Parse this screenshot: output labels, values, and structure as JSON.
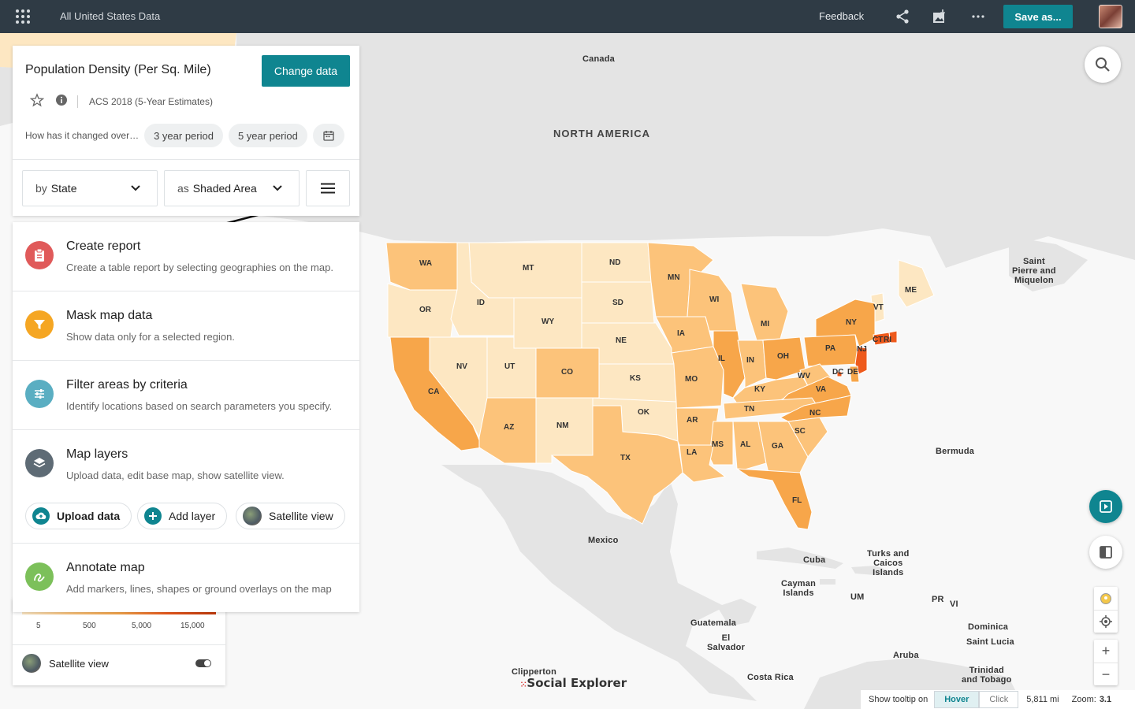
{
  "header": {
    "title": "All United States Data",
    "feedback_label": "Feedback",
    "save_label": "Save as..."
  },
  "panel": {
    "title": "Population Density (Per Sq. Mile)",
    "change_data_label": "Change data",
    "source": "ACS 2018 (5-Year Estimates)",
    "change_prompt": "How has it changed over…",
    "period_3": "3 year period",
    "period_5": "5 year period",
    "by_prefix": "by",
    "by_value": "State",
    "as_prefix": "as",
    "as_value": "Shaded Area"
  },
  "menu": {
    "create_report": {
      "title": "Create report",
      "desc": "Create a table report by selecting geographies on the map."
    },
    "mask": {
      "title": "Mask map data",
      "desc": "Show data only for a selected region."
    },
    "filter": {
      "title": "Filter areas by criteria",
      "desc": "Identify locations based on search parameters you specify."
    },
    "layers": {
      "title": "Map layers",
      "desc": "Upload data, edit base map, show satellite view."
    },
    "upload_label": "Upload data",
    "add_layer_label": "Add layer",
    "satellite_label": "Satellite view",
    "annotate": {
      "title": "Annotate map",
      "desc": "Add markers, lines, shapes or ground overlays on the map"
    }
  },
  "legend": {
    "ticks": [
      "5",
      "500",
      "5,000",
      "15,000"
    ],
    "satellite_label": "Satellite view"
  },
  "map_labels": {
    "canada": "Canada",
    "north_america": "NORTH AMERICA",
    "spm": "Saint\nPierre and\nMiquelon",
    "bermuda": "Bermuda",
    "mexico": "Mexico",
    "cuba": "Cuba",
    "turks": "Turks and\nCaicos\nIslands",
    "cayman": "Cayman\nIslands",
    "um": "UM",
    "pr": "PR",
    "vi": "VI",
    "dominica": "Dominica",
    "saint_lucia": "Saint Lucia",
    "guatemala": "Guatemala",
    "el_salvador": "El\nSalvador",
    "aruba": "Aruba",
    "trinidad": "Trinidad\nand Tobago",
    "clipperton": "Clipperton",
    "costa_rica": "Costa Rica"
  },
  "states": [
    "WA",
    "MT",
    "ND",
    "MN",
    "ME",
    "OR",
    "ID",
    "SD",
    "WI",
    "VT",
    "NY",
    "MI",
    "WY",
    "NE",
    "IA",
    "PA",
    "CT",
    "RI",
    "NJ",
    "NV",
    "UT",
    "CO",
    "KS",
    "IL",
    "IN",
    "OH",
    "DE",
    "DC",
    "CA",
    "MO",
    "WV",
    "KY",
    "VA",
    "OK",
    "TN",
    "AR",
    "NC",
    "AZ",
    "NM",
    "SC",
    "TX",
    "MS",
    "AL",
    "GA",
    "LA",
    "FL"
  ],
  "status": {
    "tooltip_label": "Show tooltip on",
    "hover": "Hover",
    "click": "Click",
    "scale": "5,811 mi",
    "zoom_label": "Zoom:",
    "zoom_value": "3.1"
  },
  "logo": "Social Explorer",
  "colors": {
    "teal": "#0f8590",
    "topbar": "#2f3b45",
    "density_low": "#fde7c2",
    "density_mid": "#fcc37a",
    "density_high": "#f7a64a",
    "density_max": "#ee5a1c"
  }
}
